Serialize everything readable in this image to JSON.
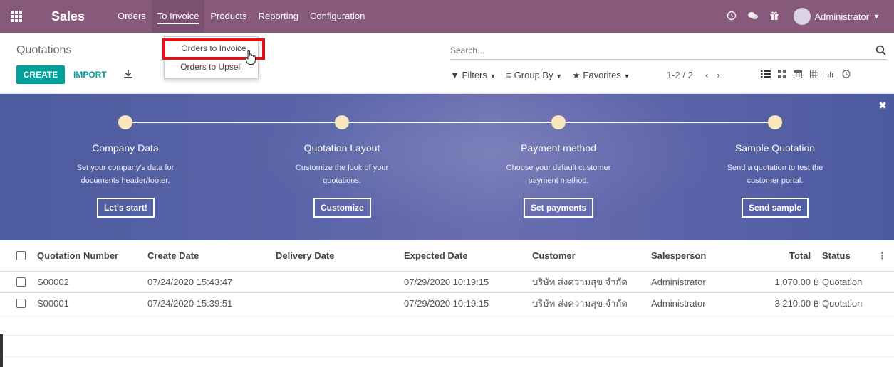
{
  "navbar": {
    "brand": "Sales",
    "menu": [
      {
        "label": "Orders"
      },
      {
        "label": "To Invoice"
      },
      {
        "label": "Products"
      },
      {
        "label": "Reporting"
      },
      {
        "label": "Configuration"
      }
    ],
    "user": "Administrator",
    "bg_color": "#875a7b"
  },
  "control_panel": {
    "breadcrumb": "Quotations",
    "create_label": "CREATE",
    "import_label": "IMPORT",
    "search_placeholder": "Search...",
    "filters_label": "Filters",
    "group_by_label": "Group By",
    "favorites_label": "Favorites",
    "pager": "1-2 / 2",
    "accent_color": "#00a09d"
  },
  "dropdown": {
    "items": [
      {
        "label": "Orders to Invoice",
        "highlighted": true
      },
      {
        "label": "Orders to Upsell"
      }
    ]
  },
  "banner": {
    "steps": [
      {
        "title": "Company Data",
        "desc1": "Set your company's data for",
        "desc2": "documents header/footer.",
        "button": "Let's start!"
      },
      {
        "title": "Quotation Layout",
        "desc1": "Customize the look of your",
        "desc2": "quotations.",
        "button": "Customize"
      },
      {
        "title": "Payment method",
        "desc1": "Choose your default customer",
        "desc2": "payment method.",
        "button": "Set payments"
      },
      {
        "title": "Sample Quotation",
        "desc1": "Send a quotation to test the",
        "desc2": "customer portal.",
        "button": "Send sample"
      }
    ]
  },
  "table": {
    "headers": {
      "number": "Quotation Number",
      "create_date": "Create Date",
      "delivery_date": "Delivery Date",
      "expected_date": "Expected Date",
      "customer": "Customer",
      "salesperson": "Salesperson",
      "total": "Total",
      "status": "Status"
    },
    "rows": [
      {
        "number": "S00002",
        "create_date": "07/24/2020 15:43:47",
        "delivery_date": "",
        "expected_date": "07/29/2020 10:19:15",
        "customer": "บริษัท ส่งความสุข จำกัด",
        "salesperson": "Administrator",
        "total": "1,070.00 ฿",
        "status": "Quotation"
      },
      {
        "number": "S00001",
        "create_date": "07/24/2020 15:39:51",
        "delivery_date": "",
        "expected_date": "07/29/2020 10:19:15",
        "customer": "บริษัท ส่งความสุข จำกัด",
        "salesperson": "Administrator",
        "total": "3,210.00 ฿",
        "status": "Quotation"
      }
    ]
  }
}
